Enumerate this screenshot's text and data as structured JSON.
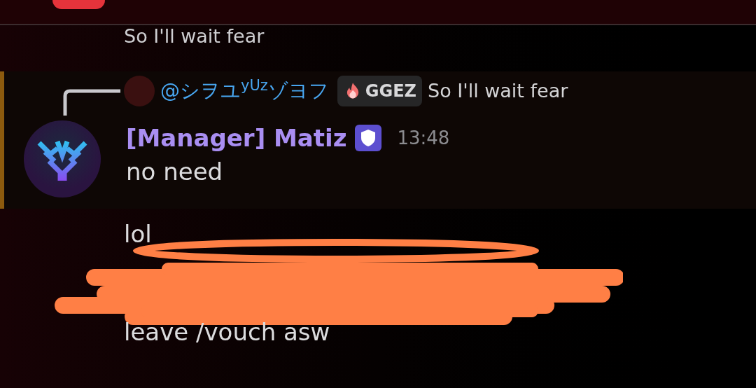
{
  "previous_message": {
    "text": "So I'll wait fear"
  },
  "reply": {
    "mention": "@シヲユ$^{yUz}$ゾヨフ",
    "tag": "GGEZ",
    "text": "So I'll wait fear"
  },
  "message": {
    "highlighted": true,
    "author": "[Manager] Matiz",
    "timestamp": "13:48",
    "text": "no need"
  },
  "followups": [
    {
      "text": "lol"
    },
    {
      "text": "leave /vouch asw"
    }
  ]
}
